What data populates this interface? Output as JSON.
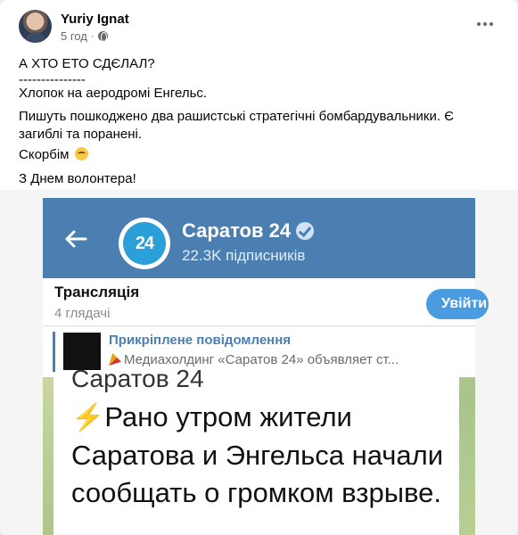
{
  "post": {
    "author": "Yuriy Ignat",
    "time": "5 год",
    "dot": "·",
    "lines": {
      "question": "А ХТО ЕТО СДЄЛАЛ?",
      "separator": "---------------",
      "headline": "Хлопок на аеродромі Енгельс.",
      "body": "Пишуть пошкоджено два рашистські стратегічні бомбардувальники. Є загиблі та поранені.",
      "mourn": "Скорбім",
      "greeting": "З Днем волонтера!"
    },
    "icons": {
      "privacy": "globe-icon",
      "menu": "more-horizontal-icon",
      "emoji": "laughing-face-emoji"
    }
  },
  "embed": {
    "channel_name": "Саратов 24",
    "logo_text": "24",
    "subscribers": "22.3K підписників",
    "live_title": "Трансляція",
    "live_viewers": "4 глядачі",
    "live_button": "Увійти",
    "pinned_title": "Прикріплене повідомлення",
    "pinned_text": "Медиахолдинг «Саратов 24» объявляет ст...",
    "message_header": "Саратов 24",
    "message_body": "Рано утром жители Саратова и Энгельса начали сообщать о громком взрыве.",
    "colors": {
      "header": "#4b7fb1",
      "accent": "#4a9be0",
      "bolt": "#f2b619"
    }
  }
}
